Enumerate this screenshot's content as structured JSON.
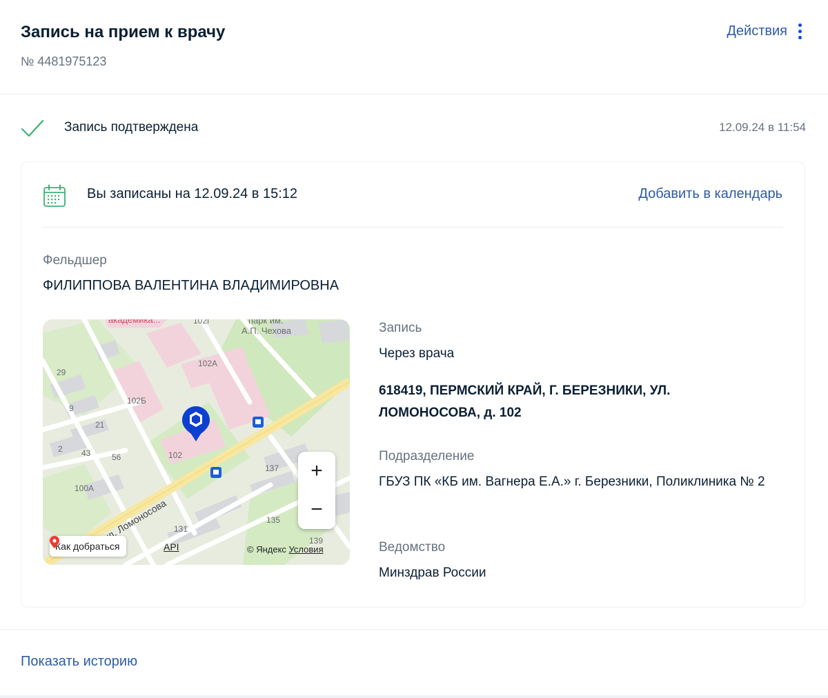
{
  "header": {
    "title": "Запись на прием к врачу",
    "number": "№ 4481975123",
    "actions_label": "Действия"
  },
  "status": {
    "text": "Запись подтверждена",
    "time": "12.09.24 в 11:54",
    "color": "#3bb273"
  },
  "appointment": {
    "text": "Вы записаны на 12.09.24 в 15:12",
    "add_to_calendar": "Добавить в календарь"
  },
  "doctor": {
    "role": "Фельдшер",
    "name": "ФИЛИППОВА ВАЛЕНТИНА ВЛАДИМИРОВНА"
  },
  "map": {
    "labels": {
      "academ": "академика...",
      "b102g": "102Г",
      "park1": "парк им.",
      "park2": "А.П. Чехова",
      "b102a": "102А",
      "b29": "29",
      "b102b": "102Б",
      "b9": "9",
      "b21": "21",
      "b2": "2",
      "b43": "43",
      "b56": "56",
      "b102": "102",
      "b137": "137",
      "b100a": "100А",
      "street": "ул. Ломоносова",
      "b131": "131",
      "b135": "135",
      "b139": "139"
    },
    "route_label": "Как добраться",
    "api_label": "API",
    "copyright": "© Яндекс",
    "terms": "Условия",
    "zoom_in": "+",
    "zoom_out": "−"
  },
  "details": {
    "record_label": "Запись",
    "record_value": "Через врача",
    "address": "618419, ПЕРМСКИЙ КРАЙ, Г. БЕРЕЗНИКИ, УЛ. ЛОМОНОСОВА, д. 102",
    "department_label": "Подразделение",
    "department_value": "ГБУЗ ПК «КБ им. Вагнера Е.А.» г. Березники, Поликлиника № 2",
    "agency_label": "Ведомство",
    "agency_value": "Минздрав России"
  },
  "footer": {
    "history_link": "Показать историю"
  },
  "colors": {
    "link": "#2c5ba8",
    "accent": "#0d4cd3",
    "marker": "#0d3fd0"
  }
}
